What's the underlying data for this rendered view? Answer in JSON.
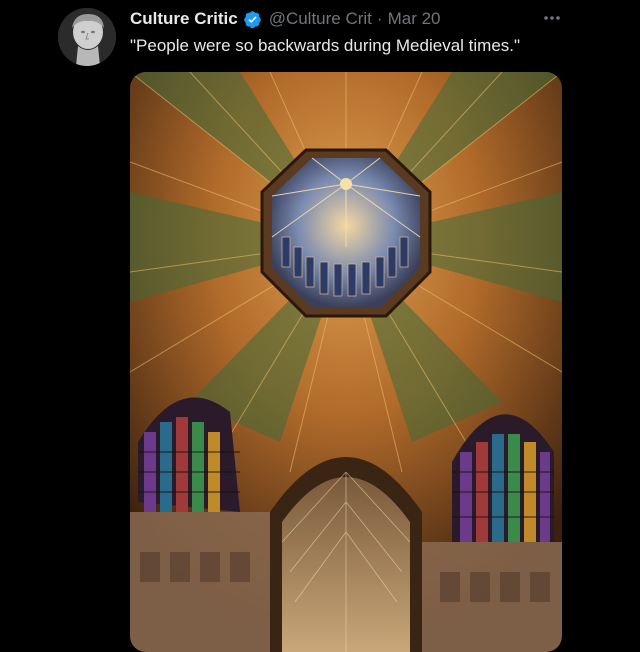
{
  "tweet": {
    "author": {
      "display_name": "Culture Critic",
      "handle": "@Culture Crit",
      "verified": true,
      "avatar_icon": "statue-head-avatar"
    },
    "separator": "·",
    "date": "Mar 20",
    "more_icon": "more-dots-icon",
    "text": "\"People were so backwards during Medieval times.\"",
    "media": {
      "icon": "cathedral-ceiling-photo"
    }
  },
  "colors": {
    "background": "#000000",
    "text_primary": "#e7e9ea",
    "text_secondary": "#71767b",
    "verified_badge": "#1d9bf0"
  }
}
